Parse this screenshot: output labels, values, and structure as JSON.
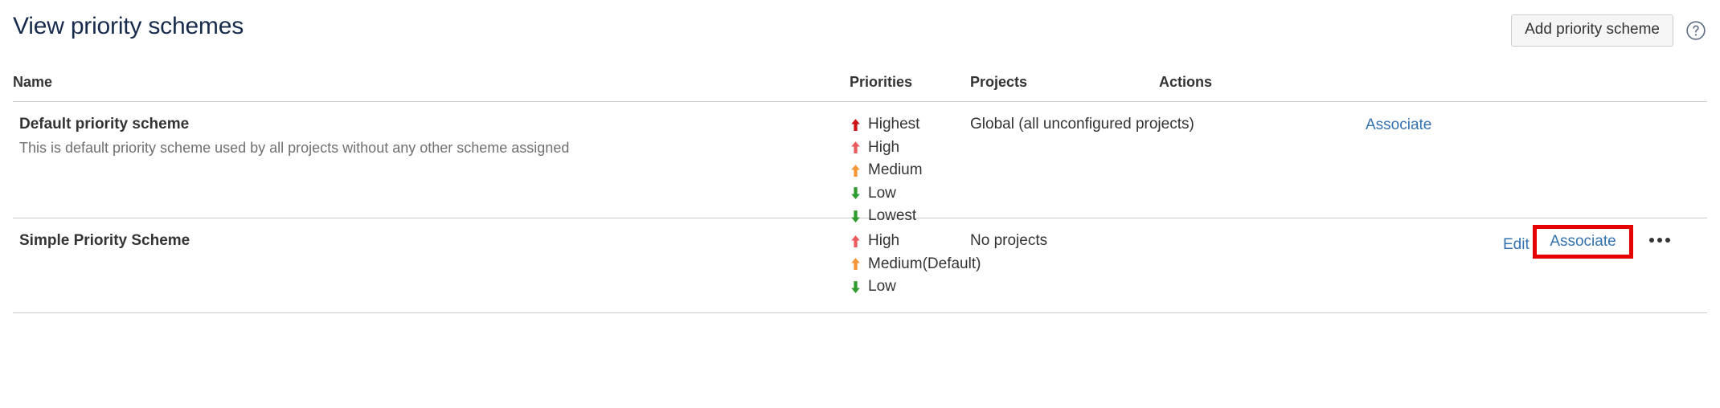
{
  "header": {
    "title": "View priority schemes",
    "add_button_label": "Add priority scheme",
    "help_icon": "question-circle-icon"
  },
  "table": {
    "columns": {
      "name": "Name",
      "priorities": "Priorities",
      "projects": "Projects",
      "actions": "Actions"
    },
    "rows": [
      {
        "name": "Default priority scheme",
        "description": "This is default priority scheme used by all projects without any other scheme assigned",
        "priorities": [
          {
            "label": "Highest",
            "icon": "arrow-up-icon",
            "color": "#cd1316"
          },
          {
            "label": "High",
            "icon": "arrow-up-icon",
            "color": "#ea5b5d"
          },
          {
            "label": "Medium",
            "icon": "arrow-up-icon",
            "color": "#f59535"
          },
          {
            "label": "Low",
            "icon": "arrow-down-icon",
            "color": "#2f9b2f"
          },
          {
            "label": "Lowest",
            "icon": "arrow-down-icon",
            "color": "#2f9b2f"
          }
        ],
        "projects": "Global (all unconfigured projects)",
        "actions": {
          "associate": "Associate"
        }
      },
      {
        "name": "Simple Priority Scheme",
        "description": "",
        "priorities": [
          {
            "label": "High",
            "icon": "arrow-up-icon",
            "color": "#ea5b5d"
          },
          {
            "label": "Medium(Default)",
            "icon": "arrow-up-icon",
            "color": "#f59535"
          },
          {
            "label": "Low",
            "icon": "arrow-down-icon",
            "color": "#2f9b2f"
          }
        ],
        "projects": "No projects",
        "actions": {
          "edit": "Edit",
          "associate": "Associate",
          "more": "more-options-icon"
        }
      }
    ]
  },
  "annotation": {
    "highlight_color": "#e50000",
    "highlight_target": "Associate"
  }
}
